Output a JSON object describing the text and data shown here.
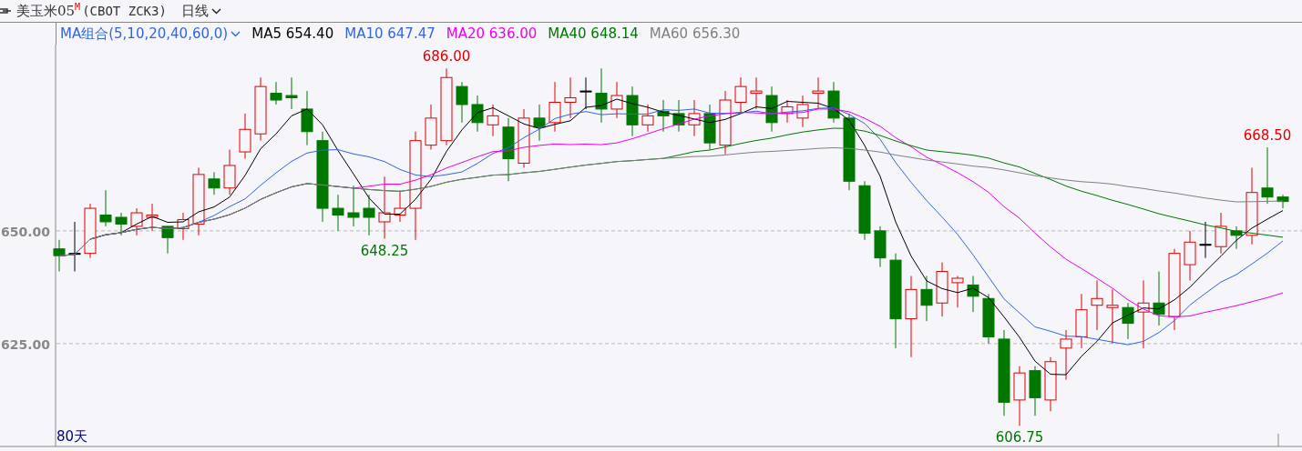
{
  "header": {
    "title": "美玉米05",
    "badge": "M",
    "code": "(CBOT ZCK3)",
    "period": "日线"
  },
  "legend": {
    "group": "MA组合(5,10,20,40,60,0)",
    "items": [
      {
        "label": "MA5",
        "value": "654.40",
        "color": "#000000"
      },
      {
        "label": "MA10",
        "value": "647.47",
        "color": "#3366dd"
      },
      {
        "label": "MA20",
        "value": "636.00",
        "color": "#ee00ee"
      },
      {
        "label": "MA40",
        "value": "648.14",
        "color": "#007700"
      },
      {
        "label": "MA60",
        "value": "656.30",
        "color": "#808080"
      }
    ]
  },
  "y_axis": {
    "labels": [
      "650.00",
      "625.00"
    ]
  },
  "price_labels": [
    {
      "text": "686.00",
      "color": "#e00000"
    },
    {
      "text": "648.25",
      "color": "#007700"
    },
    {
      "text": "606.75",
      "color": "#007700"
    },
    {
      "text": "668.50",
      "color": "#e00000"
    }
  ],
  "footer": {
    "span": "80天"
  }
}
